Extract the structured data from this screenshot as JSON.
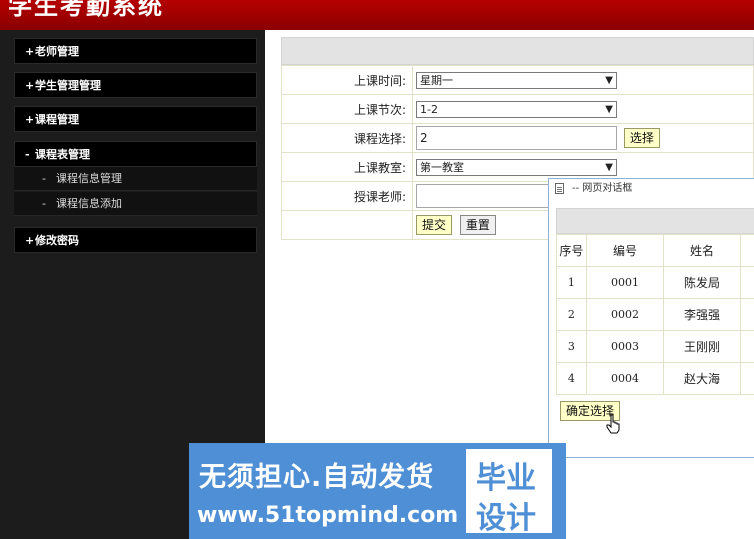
{
  "header": {
    "title": "学生考勤系统"
  },
  "sidebar": {
    "items": [
      {
        "symbol": "+",
        "label": "老师管理"
      },
      {
        "symbol": "+",
        "label": "学生管理管理"
      },
      {
        "symbol": "+",
        "label": "课程管理"
      },
      {
        "symbol": "-",
        "label": "课程表管理"
      },
      {
        "symbol": "+",
        "label": "修改密码"
      }
    ],
    "subitems": [
      {
        "symbol": "-",
        "label": "课程信息管理"
      },
      {
        "symbol": "-",
        "label": "课程信息添加"
      }
    ]
  },
  "form": {
    "time_label": "上课时间:",
    "time_value": "星期一",
    "period_label": "上课节次:",
    "period_value": "1-2",
    "course_label": "课程选择:",
    "course_value": "2",
    "choose_button": "选择",
    "room_label": "上课教室:",
    "room_value": "第一教室",
    "teacher_label": "授课老师:",
    "teacher_value": "",
    "submit_button": "提交",
    "reset_button": "重置"
  },
  "dialog": {
    "title": "-- 网页对话框",
    "columns": [
      "序号",
      "编号",
      "姓名"
    ],
    "rows": [
      [
        "1",
        "0001",
        "陈发局"
      ],
      [
        "2",
        "0002",
        "李强强"
      ],
      [
        "3",
        "0003",
        "王刚刚"
      ],
      [
        "4",
        "0004",
        "赵大海"
      ]
    ],
    "confirm_button": "确定选择"
  },
  "watermark": {
    "line1": "无须担心.自动发货",
    "line2": "www.51topmind.com",
    "box_line1": "毕业",
    "box_line2": "设计"
  },
  "colors": {
    "header_red": "#a00000",
    "sidebar_bg": "#1c1c1c",
    "button_yellow": "#ffffc8",
    "watermark_blue": "#4f8fd6"
  }
}
